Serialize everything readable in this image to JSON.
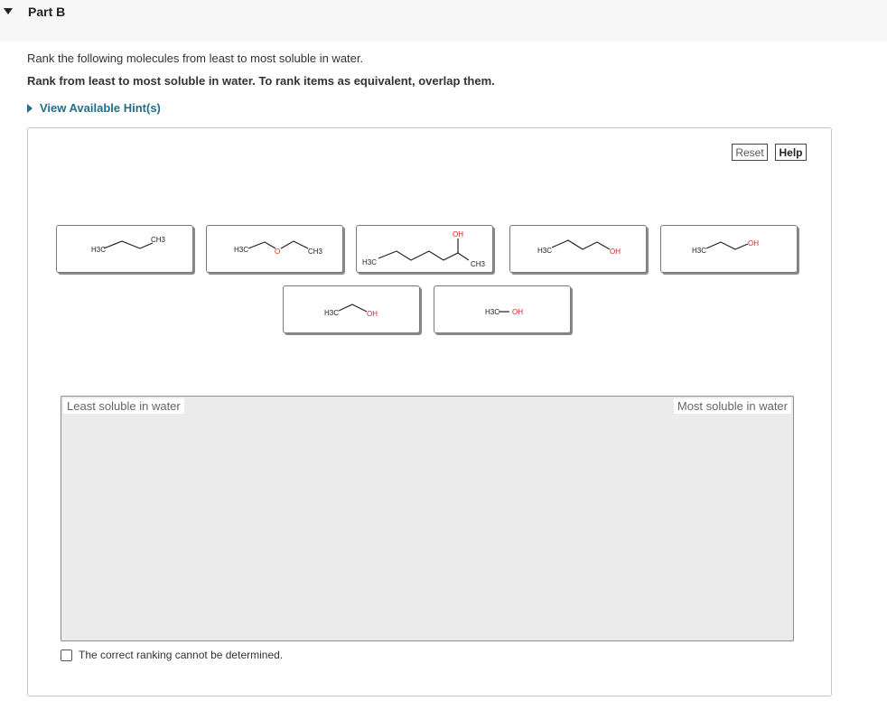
{
  "part": {
    "title": "Part B"
  },
  "question": {
    "instruction": "Rank the following molecules from least to most soluble in water.",
    "instruction_bold": "Rank from least to most soluble in water. To rank items as equivalent, overlap them."
  },
  "hint": {
    "label": "View Available Hint(s)"
  },
  "toolbar": {
    "reset_label": "Reset",
    "help_label": "Help"
  },
  "molecules": [
    {
      "id": "butane",
      "labels": {
        "left": "H3C",
        "right": "CH3"
      }
    },
    {
      "id": "diethyl-ether",
      "labels": {
        "left": "H3C",
        "o": "O",
        "right": "CH3"
      }
    },
    {
      "id": "hexan-2-ol",
      "labels": {
        "left": "H3C",
        "oh": "OH",
        "right": "CH3"
      }
    },
    {
      "id": "butanol",
      "labels": {
        "left": "H3C",
        "oh": "OH"
      }
    },
    {
      "id": "propanol",
      "labels": {
        "left": "H3C",
        "oh": "OH"
      }
    },
    {
      "id": "ethanol",
      "labels": {
        "left": "H3C",
        "oh": "OH"
      }
    },
    {
      "id": "methanol",
      "labels": {
        "left": "H3C",
        "oh": "OH"
      }
    }
  ],
  "ranking": {
    "least_label": "Least soluble in water",
    "most_label": "Most soluble in water"
  },
  "checkbox": {
    "label": "The correct ranking cannot be determined.",
    "checked": false
  },
  "colors": {
    "link": "#1f6e8c",
    "oxygen": "#dd2222"
  }
}
